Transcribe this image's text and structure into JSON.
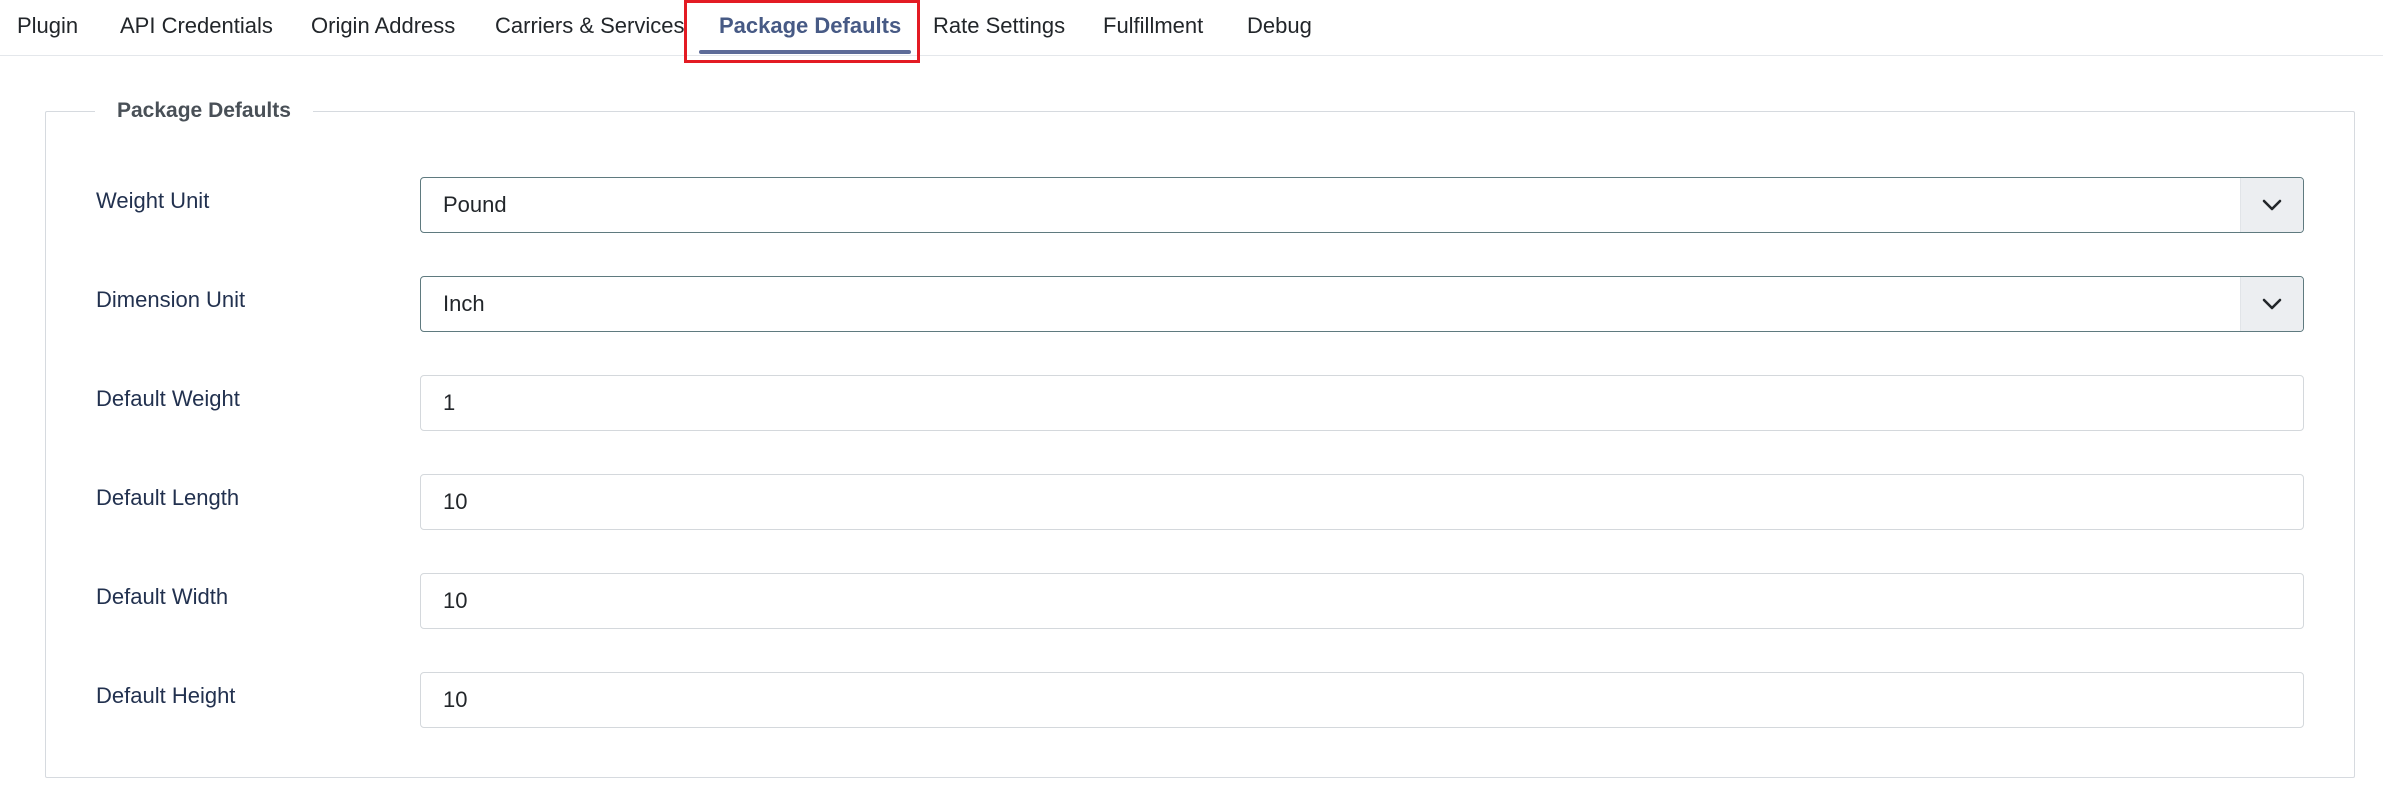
{
  "tabs": [
    {
      "label": "Plugin",
      "active": false
    },
    {
      "label": "API Credentials",
      "active": false
    },
    {
      "label": "Origin Address",
      "active": false
    },
    {
      "label": "Carriers & Services",
      "active": false
    },
    {
      "label": "Package Defaults",
      "active": true
    },
    {
      "label": "Rate Settings",
      "active": false
    },
    {
      "label": "Fulfillment",
      "active": false
    },
    {
      "label": "Debug",
      "active": false
    }
  ],
  "section": {
    "legend": "Package Defaults",
    "fields": {
      "weight_unit": {
        "label": "Weight Unit",
        "value": "Pound"
      },
      "dimension_unit": {
        "label": "Dimension Unit",
        "value": "Inch"
      },
      "default_weight": {
        "label": "Default Weight",
        "value": "1"
      },
      "default_length": {
        "label": "Default Length",
        "value": "10"
      },
      "default_width": {
        "label": "Default Width",
        "value": "10"
      },
      "default_height": {
        "label": "Default Height",
        "value": "10"
      }
    }
  },
  "colors": {
    "active_tab": "#475a85",
    "highlight": "#e31b23",
    "select_border": "#5f7a7f"
  },
  "icons": {
    "select_arrow": "chevron-down-icon"
  }
}
